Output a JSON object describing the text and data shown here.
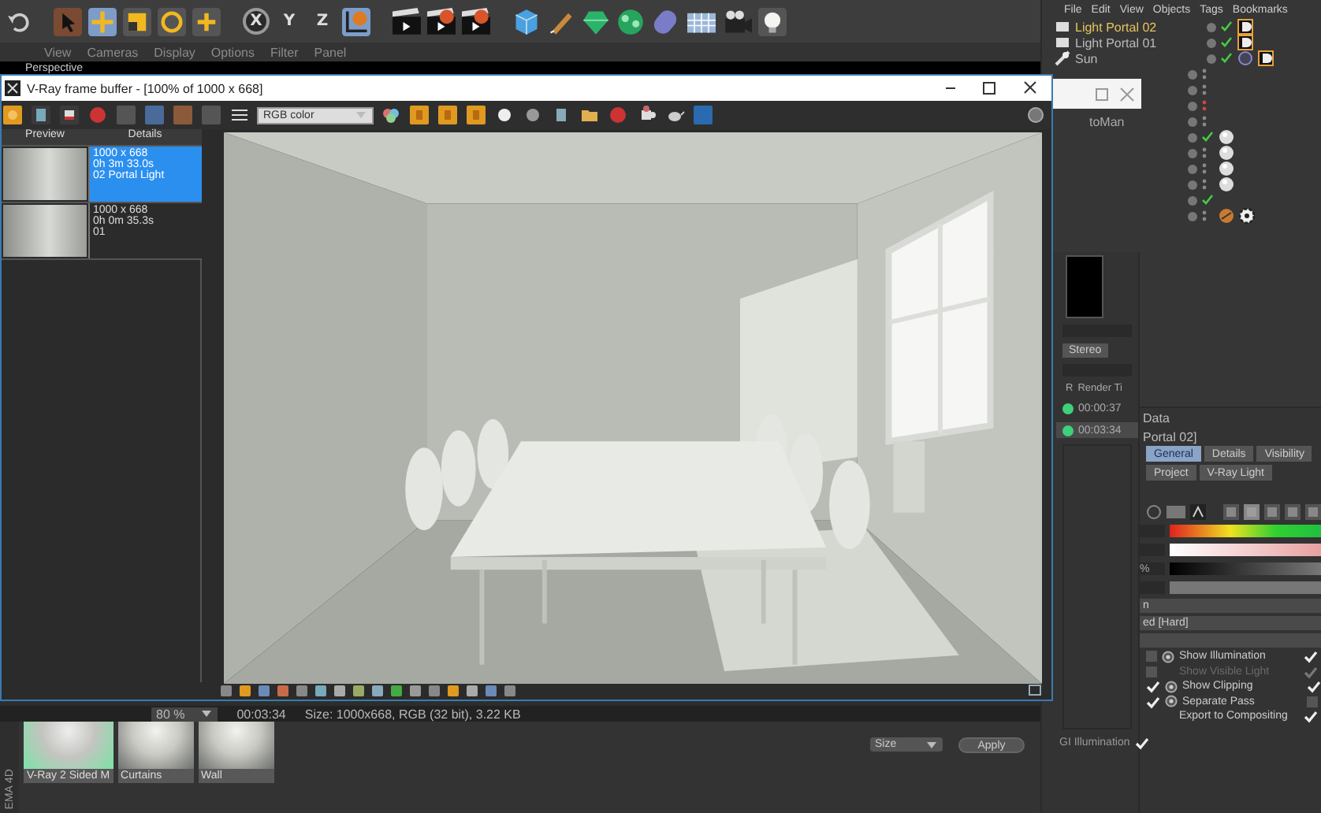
{
  "toolbar": {
    "axes": [
      "X",
      "Y",
      "Z"
    ]
  },
  "viewport": {
    "menu": [
      "View",
      "Cameras",
      "Display",
      "Options",
      "Filter",
      "Panel"
    ],
    "camera": "Perspective"
  },
  "object_manager": {
    "menu": [
      "File",
      "Edit",
      "View",
      "Objects",
      "Tags",
      "Bookmarks"
    ],
    "objects": [
      {
        "name": "Light Portal 02",
        "selected": true
      },
      {
        "name": "Light Portal 01",
        "selected": false
      },
      {
        "name": "Sun",
        "selected": false
      }
    ],
    "clipped_name": "toMan"
  },
  "render_queue": {
    "button": "Stereo",
    "columns": [
      "R",
      "Render Ti"
    ],
    "rows": [
      {
        "time": "00:00:37",
        "selected": false
      },
      {
        "time": "00:03:34",
        "selected": true
      }
    ],
    "gi": {
      "label": "GI Illumination",
      "checked": true
    }
  },
  "attributes": {
    "title": "Data",
    "object": "Portal 02]",
    "tabs": [
      {
        "label": "General",
        "selected": true
      },
      {
        "label": "Details",
        "selected": false
      },
      {
        "label": "Visibility",
        "selected": false
      },
      {
        "label": "Project",
        "selected": false
      },
      {
        "label": "V-Ray Light",
        "selected": false
      }
    ],
    "unit": "%",
    "fields": [
      "n",
      "ed [Hard]"
    ],
    "options": [
      {
        "label": "Show Illumination",
        "enabled": false,
        "checked": true,
        "disabled": false,
        "icon": true
      },
      {
        "label": "Show Visible Light",
        "enabled": false,
        "checked": true,
        "disabled": true,
        "icon": false
      },
      {
        "label": "Show Clipping",
        "enabled": true,
        "checked": true,
        "disabled": false,
        "icon": true
      },
      {
        "label": "Separate Pass",
        "enabled": true,
        "checked": false,
        "disabled": false,
        "icon": true
      },
      {
        "label": "Export to Compositing",
        "checked": true,
        "disabled": false,
        "icon": false
      }
    ]
  },
  "vfb": {
    "title": "V-Ray frame buffer - [100% of 1000 x 668]",
    "channel": "RGB color",
    "history": {
      "columns": [
        "Preview",
        "Details"
      ],
      "items": [
        {
          "lines": [
            "1000 x 668",
            "0h 3m 33.0s",
            "02 Portal Light"
          ],
          "selected": true
        },
        {
          "lines": [
            "1000 x 668",
            "0h 0m 35.3s",
            "01"
          ],
          "selected": false
        }
      ]
    }
  },
  "viewer_status": {
    "zoom": "80 %",
    "time": "00:03:34",
    "info": "Size: 1000x668, RGB (32 bit), 3.22 KB"
  },
  "materials": [
    "V-Ray 2 Sided M",
    "Curtains",
    "Wall"
  ],
  "sidebar_label": "EMA 4D",
  "apply_bar": {
    "dropdown": "Size",
    "button": "Apply"
  }
}
